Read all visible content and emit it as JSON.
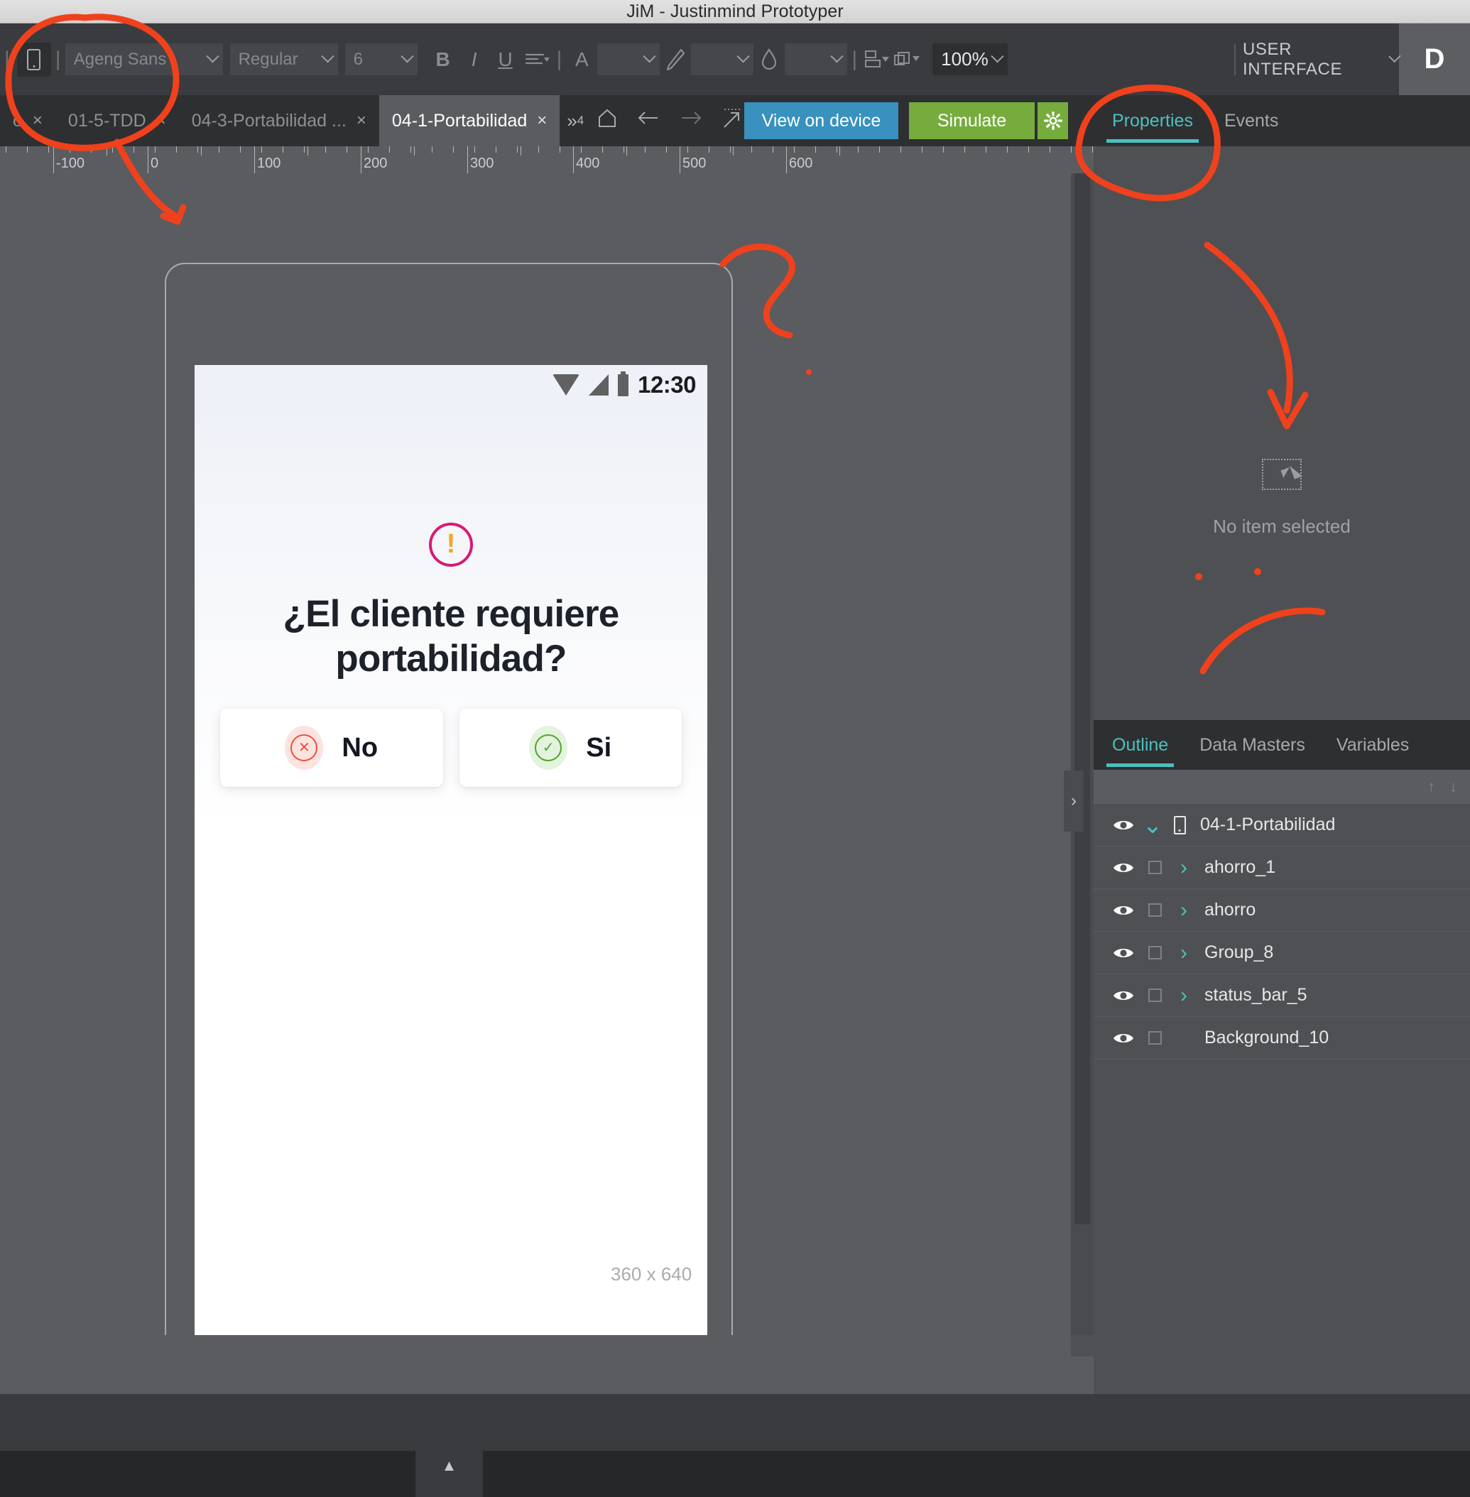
{
  "window": {
    "title": "JiM - Justinmind Prototyper"
  },
  "toolbar": {
    "device_icon": "phone-icon",
    "font_family": "Ageng Sans",
    "font_weight": "Regular",
    "font_size": "6",
    "bold_label": "B",
    "italic_label": "I",
    "underline_label": "U",
    "align_icon": "text-align-icon",
    "text_color_label": "A",
    "pencil_icon": "pencil-icon",
    "droplet_icon": "droplet-icon",
    "distribute_icon": "distribute-icon",
    "layers_icon": "layers-icon",
    "zoom_level": "100%",
    "ui_mode": "USER INTERFACE",
    "avatar_initial": "D"
  },
  "tabs": [
    {
      "label": "o",
      "active": false,
      "truncated": true
    },
    {
      "label": "01-5-TDD",
      "active": false
    },
    {
      "label": "04-3-Portabilidad ...",
      "active": false
    },
    {
      "label": "04-1-Portabilidad",
      "active": true
    }
  ],
  "tab_overflow": "»",
  "tab_overflow_count": "4",
  "nav": {
    "home_icon": "home-icon",
    "back_icon": "arrow-left-icon",
    "forward_icon": "arrow-right-icon",
    "expand_icon": "expand-arrow-icon",
    "view_on_device": "View on device",
    "simulate": "Simulate",
    "simulate_settings_icon": "gear-icon"
  },
  "ruler": {
    "labels": [
      "-100",
      "0",
      "100",
      "200",
      "300",
      "400",
      "500",
      "600"
    ],
    "positions": [
      75,
      208,
      358,
      508,
      658,
      807,
      957,
      1107
    ]
  },
  "canvas": {
    "device_size_label": "360 x 640",
    "collapse_icon": "chevron-right-icon"
  },
  "phone": {
    "status": {
      "wifi_icon": "wifi-icon",
      "signal_icon": "signal-icon",
      "battery_icon": "battery-icon",
      "time": "12:30"
    },
    "alert_icon": "exclamation-circle-icon",
    "question": "¿El cliente requiere portabilidad?",
    "choices": [
      {
        "label": "No",
        "icon": "x-circle-icon",
        "accent": "#ef4f3b",
        "bg": "#fde3e0"
      },
      {
        "label": "Si",
        "icon": "check-circle-icon",
        "accent": "#4fa52b",
        "bg": "#e4f3dd"
      }
    ]
  },
  "properties_panel": {
    "tabs": [
      {
        "label": "Properties",
        "active": true
      },
      {
        "label": "Events",
        "active": false
      }
    ],
    "empty_icon": "selection-cursor-icon",
    "empty_text": "No item selected"
  },
  "outline_panel": {
    "tabs": [
      {
        "label": "Outline",
        "active": true
      },
      {
        "label": "Data Masters",
        "active": false
      },
      {
        "label": "Variables",
        "active": false
      }
    ],
    "toolstrip": {
      "move_up_icon": "arrow-up-icon",
      "move_down_icon": "arrow-down-icon"
    },
    "rows": [
      {
        "label": "04-1-Portabilidad",
        "type": "screen",
        "expanded": true,
        "eye": "eye-icon",
        "indent": 0
      },
      {
        "label": "ahorro_1",
        "type": "group",
        "expanded": false,
        "eye": "eye-icon",
        "indent": 1
      },
      {
        "label": "ahorro",
        "type": "group",
        "expanded": false,
        "eye": "eye-icon",
        "indent": 1
      },
      {
        "label": "Group_8",
        "type": "group",
        "expanded": false,
        "eye": "eye-icon",
        "indent": 1
      },
      {
        "label": "status_bar_5",
        "type": "group",
        "expanded": false,
        "eye": "eye-icon",
        "indent": 1
      },
      {
        "label": "Background_10",
        "type": "leaf",
        "expanded": false,
        "eye": "eye-icon",
        "indent": 1
      }
    ]
  },
  "colors": {
    "accent_teal": "#4cc0c0",
    "view_device_blue": "#3891bf",
    "simulate_green": "#76ac3e",
    "panel_dark": "#2e2f31",
    "panel_mid": "#4f5053",
    "canvas_gray": "#5a5c60",
    "annotation_red": "#f0411d"
  }
}
